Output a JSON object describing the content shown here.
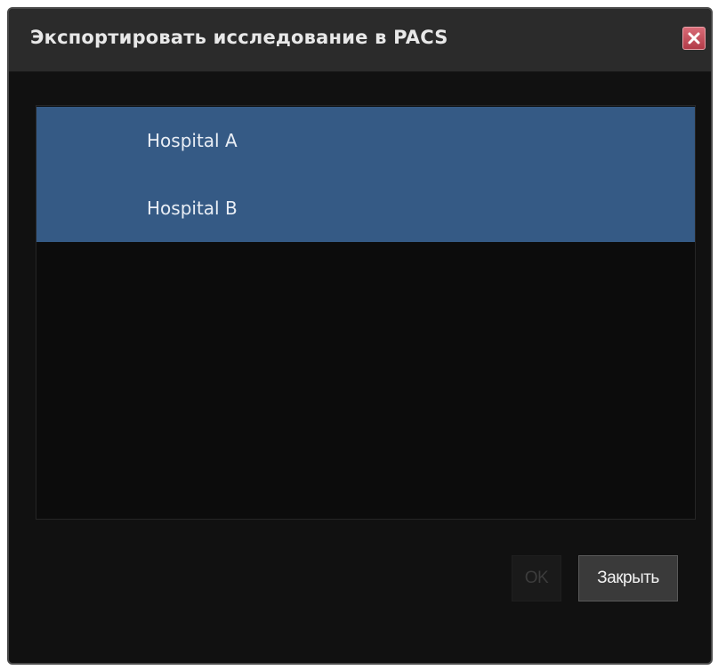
{
  "dialog": {
    "title": "Экспортировать исследование в PACS",
    "close_icon": "close-x-icon",
    "close_color": "#c4414e"
  },
  "pacs_list": {
    "items": [
      {
        "label": "Hospital A"
      },
      {
        "label": "Hospital B"
      }
    ],
    "selected_color": "#355a85"
  },
  "footer": {
    "ok_label": "OK",
    "close_label": "Закрыть"
  }
}
